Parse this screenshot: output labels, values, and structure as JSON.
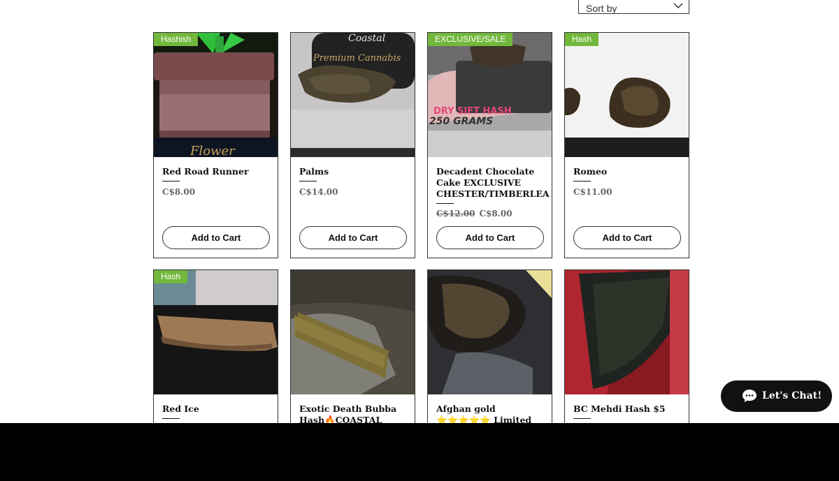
{
  "sort": {
    "label": "Sort by",
    "icon": "chevron-down-icon"
  },
  "products_row1": [
    {
      "ribbon": "Hashish",
      "name": "Red Road Runner",
      "price": "C$8.00",
      "old_price": "",
      "button": "Add to Cart",
      "image_text": "Flower"
    },
    {
      "ribbon": "",
      "name": "Palms",
      "price": "C$14.00",
      "old_price": "",
      "button": "Add to Cart",
      "image_text": "Premium Cannabis"
    },
    {
      "ribbon": "EXCLUSIVE/SALE",
      "name": "Decadent Chocolate Cake EXCLUSIVE CHESTER/TIMBERLEA",
      "price": "C$8.00",
      "old_price": "C$12.00",
      "button": "Add to Cart",
      "image_text": "250 GRAMS"
    },
    {
      "ribbon": "Hash",
      "name": "Romeo",
      "price": "C$11.00",
      "old_price": "",
      "button": "Add to Cart",
      "image_text": ""
    }
  ],
  "products_row2": [
    {
      "ribbon": "Hash",
      "name": "Red Ice"
    },
    {
      "ribbon": "",
      "name": "Exotic Death Bubba Hash🔥COASTAL"
    },
    {
      "ribbon": "",
      "name": "Afghan gold ⭐⭐⭐⭐⭐ Limited amount very"
    },
    {
      "ribbon": "",
      "name": "BC Mehdi Hash $5"
    }
  ],
  "chat": {
    "label": "Let's Chat!",
    "icon": "chat-bubble-icon"
  },
  "colors": {
    "ribbon": "#72b83d",
    "chat_bg": "#111111",
    "border": "#333333"
  }
}
